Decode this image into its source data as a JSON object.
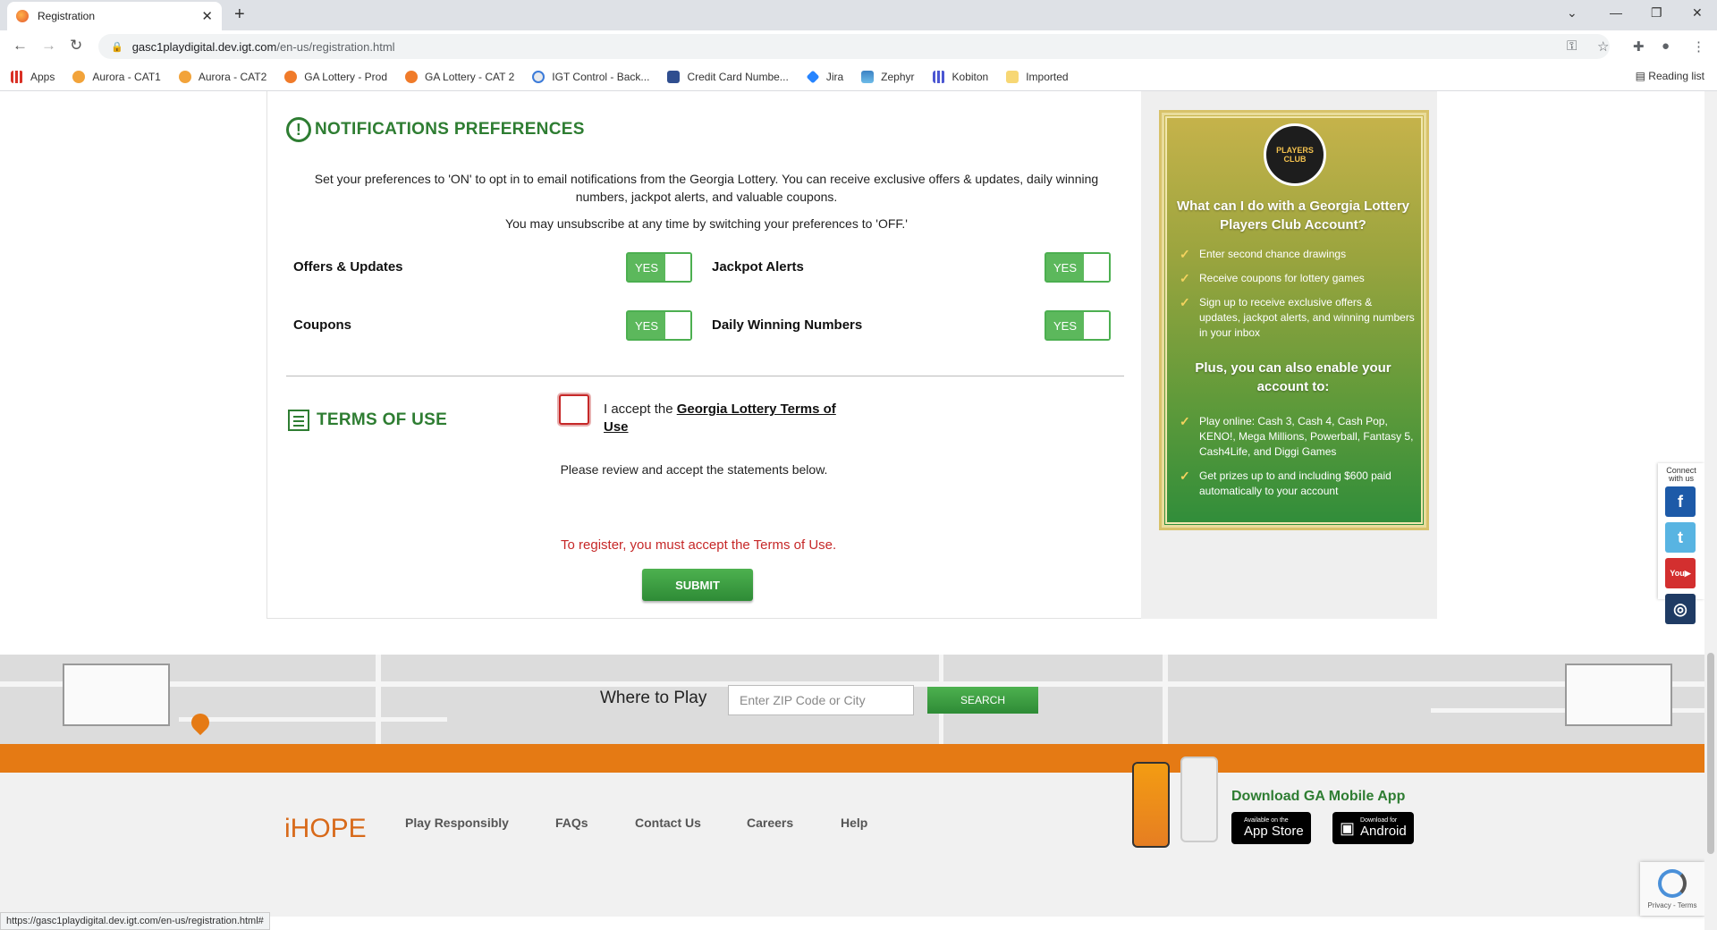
{
  "browser": {
    "tab_title": "Registration",
    "url_host": "gasc1playdigital.dev.igt.com",
    "url_path": "/en-us/registration.html",
    "bookmarks": [
      "Apps",
      "Aurora - CAT1",
      "Aurora - CAT2",
      "GA Lottery - Prod",
      "GA Lottery - CAT 2",
      "IGT Control - Back...",
      "Credit Card Numbe...",
      "Jira",
      "Zephyr",
      "Kobiton",
      "Imported"
    ],
    "reading_list": "Reading list",
    "status_url": "https://gasc1playdigital.dev.igt.com/en-us/registration.html#"
  },
  "notifications": {
    "title": "NOTIFICATIONS PREFERENCES",
    "intro": "Set your preferences to 'ON' to opt in to email notifications from the Georgia Lottery. You can receive exclusive offers & updates, daily winning numbers, jackpot alerts, and valuable coupons.",
    "unsubscribe": "You may unsubscribe at any time by switching your preferences to 'OFF.'",
    "prefs": [
      {
        "label": "Offers & Updates",
        "state": "YES"
      },
      {
        "label": "Jackpot Alerts",
        "state": "YES"
      },
      {
        "label": "Coupons",
        "state": "YES"
      },
      {
        "label": "Daily Winning Numbers",
        "state": "YES"
      }
    ]
  },
  "terms": {
    "title": "TERMS OF USE",
    "review": "Please review and accept the statements below.",
    "accept_prefix": "I accept the ",
    "accept_link": "Georgia Lottery Terms of Use",
    "error": "To register, you must accept the Terms of Use.",
    "submit": "SUBMIT"
  },
  "club": {
    "logo_text": "PLAYERS CLUB",
    "heading1": "What can I do with a Georgia Lottery Players Club Account?",
    "list1": [
      "Enter second chance drawings",
      "Receive coupons for lottery games",
      "Sign up to receive exclusive offers & updates, jackpot alerts, and winning numbers in your inbox"
    ],
    "heading2": "Plus, you can also enable your account to:",
    "list2": [
      "Play online: Cash 3, Cash 4, Cash Pop, KENO!, Mega Millions, Powerball, Fantasy 5, Cash4Life, and Diggi Games",
      "Get prizes up to and including $600 paid automatically to your account"
    ]
  },
  "social": {
    "caption": "Connect with us"
  },
  "where_to_play": {
    "label": "Where to Play",
    "placeholder": "Enter ZIP Code or City",
    "button": "SEARCH"
  },
  "footer": {
    "logo": "iHOPE",
    "links": [
      "Play Responsibly",
      "FAQs",
      "Contact Us",
      "Careers",
      "Help"
    ],
    "download": "Download GA Mobile App",
    "appstore_small": "Available on the",
    "appstore_big": "App Store",
    "android_small": "Download for",
    "android_big": "Android"
  },
  "captcha": {
    "text": "Privacy - Terms"
  },
  "colors": {
    "brand_green": "#2e7d32",
    "toggle_green": "#5cb85c",
    "orange": "#e57a14",
    "error_red": "#c62828"
  }
}
